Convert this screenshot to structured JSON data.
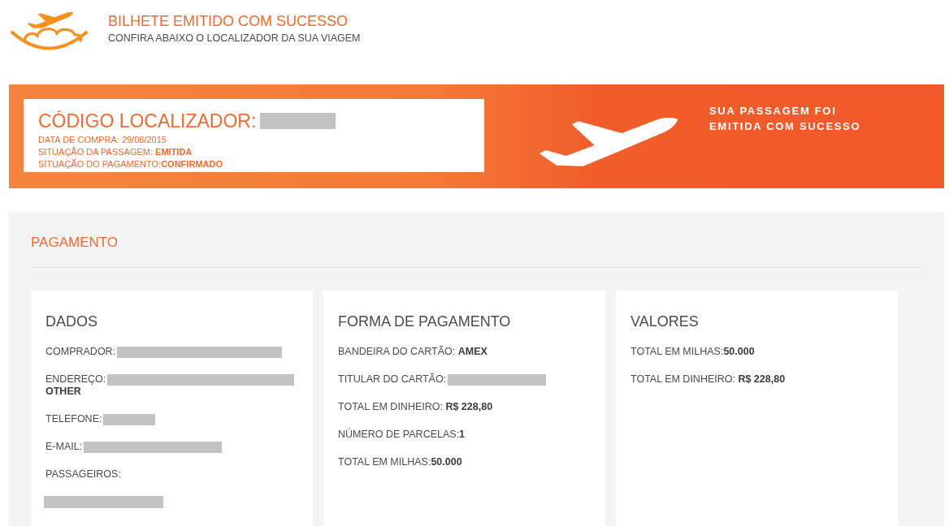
{
  "header": {
    "title": "BILHETE EMITIDO COM SUCESSO",
    "subtitle": "CONFIRA ABAIXO O LOCALIZADOR DA SUA VIAGEM"
  },
  "banner": {
    "locator": {
      "label": "CÓDIGO LOCALIZADOR:",
      "redacted": true
    },
    "details": [
      "DATA DE COMPRA: 29/08/2015",
      "SITUAÇÃO DA PASSAGEM: **EMITIDA**",
      "SITUAÇÃO DO PAGAMENTO:**CONFIRMADO**"
    ],
    "message": [
      "SUA PASSAGEM FOI",
      "EMITIDA COM SUCESSO"
    ]
  },
  "payment": {
    "title": "PAGAMENTO",
    "cards": [
      {
        "title": "DADOS",
        "fields": [
          {
            "text": "COMPRADOR:",
            "redacted": true
          },
          {
            "text": "ENDEREÇO:",
            "redacted": true,
            "note": "OTHER"
          },
          {
            "text": "TELEFONE:",
            "redacted": true
          },
          {
            "text": "E-MAIL:",
            "redacted": true
          },
          {
            "text": "PASSAGEIROS:",
            "redacted": false
          },
          {
            "redacted": true
          }
        ]
      },
      {
        "title": "FORMA DE PAGAMENTO",
        "fields": [
          {
            "text": "BANDEIRA DO CARTÃO: **AMEX**",
            "redacted": false
          },
          {
            "text": "TITULAR DO CARTÃO:",
            "redacted": true
          },
          {
            "text": "TOTAL EM DINHEIRO: **R$ 228,80**",
            "redacted": false
          },
          {
            "text": "NÚMERO DE PARCELAS:**1**",
            "redacted": false
          },
          {
            "text": "TOTAL EM MILHAS:**50.000**",
            "redacted": false
          }
        ]
      },
      {
        "title": "VALORES",
        "fields": [
          {
            "text": "TOTAL EM MILHAS:**50.000**",
            "redacted": false
          },
          {
            "text": "TOTAL EM DINHEIRO: **R$ 228,80**",
            "redacted": false
          }
        ]
      }
    ]
  }
}
